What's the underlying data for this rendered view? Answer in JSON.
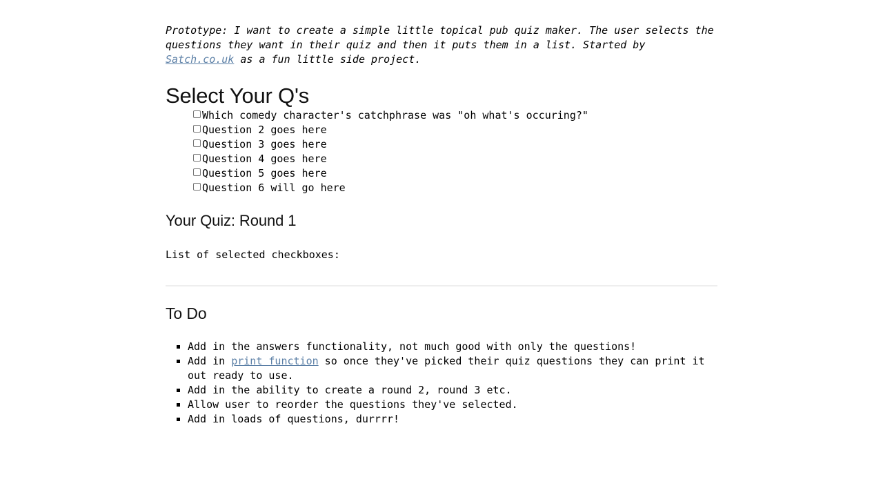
{
  "intro": {
    "text_before_link": "Prototype: I want to create a simple little topical pub quiz maker. The user selects the questions they want in their quiz and then it puts them in a list. Started by ",
    "link_label": "Satch.co.uk",
    "text_after_link": " as a fun little side project."
  },
  "headings": {
    "select_questions": "Select Your Q's",
    "your_quiz": "Your Quiz: Round 1",
    "todo": "To Do"
  },
  "questions": [
    {
      "label": "Which comedy character's catchphrase was \"oh what's occuring?\"",
      "checked": false
    },
    {
      "label": "Question 2 goes here",
      "checked": false
    },
    {
      "label": "Question 3 goes here",
      "checked": false
    },
    {
      "label": "Question 4 goes here",
      "checked": false
    },
    {
      "label": "Question 5 goes here",
      "checked": false
    },
    {
      "label": "Question 6 will go here",
      "checked": false
    }
  ],
  "quiz": {
    "selected_list_label": "List of selected checkboxes:",
    "selected_items": []
  },
  "todo_items": [
    {
      "text_before_link": "Add in the answers functionality, not much good with only the questions!",
      "link_label": "",
      "text_after_link": ""
    },
    {
      "text_before_link": "Add in ",
      "link_label": "print function",
      "text_after_link": " so once they've picked their quiz questions they can print it out ready to use."
    },
    {
      "text_before_link": "Add in the ability to create a round 2, round 3 etc.",
      "link_label": "",
      "text_after_link": ""
    },
    {
      "text_before_link": "Allow user to reorder the questions they've selected.",
      "link_label": "",
      "text_after_link": ""
    },
    {
      "text_before_link": "Add in loads of questions, durrrr!",
      "link_label": "",
      "text_after_link": ""
    }
  ],
  "colors": {
    "link": "#5b7fa6",
    "text": "#000000",
    "background": "#ffffff",
    "divider": "#eeeeee"
  }
}
